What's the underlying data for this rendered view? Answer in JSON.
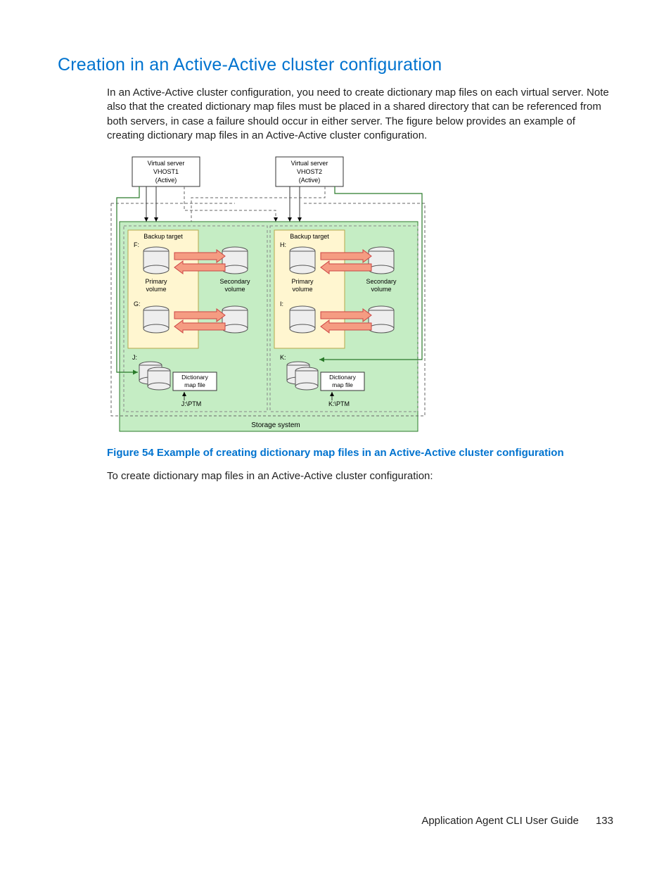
{
  "heading": "Creation in an Active-Active cluster configuration",
  "paragraph1": "In an Active-Active cluster configuration, you need to create dictionary map files on each virtual server. Note also that the created dictionary map files must be placed in a shared directory that can be referenced from both servers, in case a failure should occur in either server. The figure below provides an example of creating dictionary map files in an Active-Active cluster configuration.",
  "figure_caption": "Figure 54 Example of creating dictionary map files in an Active-Active cluster configuration",
  "paragraph2": "To create dictionary map files in an Active-Active cluster configuration:",
  "footer_title": "Application Agent CLI User Guide",
  "page_number": "133",
  "diagram": {
    "vhost1_l1": "Virtual server",
    "vhost1_l2": "VHOST1",
    "vhost1_l3": "(Active)",
    "vhost2_l1": "Virtual server",
    "vhost2_l2": "VHOST2",
    "vhost2_l3": "(Active)",
    "backup1": "Backup target",
    "backup2": "Backup target",
    "drive_f": "F:",
    "drive_g": "G:",
    "drive_h": "H:",
    "drive_i": "I:",
    "drive_j": "J:",
    "drive_k": "K:",
    "primary_l1": "Primary",
    "primary_l2": "volume",
    "secondary_l1": "Secondary",
    "secondary_l2": "volume",
    "dict_l1": "Dictionary",
    "dict_l2": "map file",
    "path_j": "J:\\PTM",
    "path_k": "K:\\PTM",
    "storage_system": "Storage system"
  }
}
